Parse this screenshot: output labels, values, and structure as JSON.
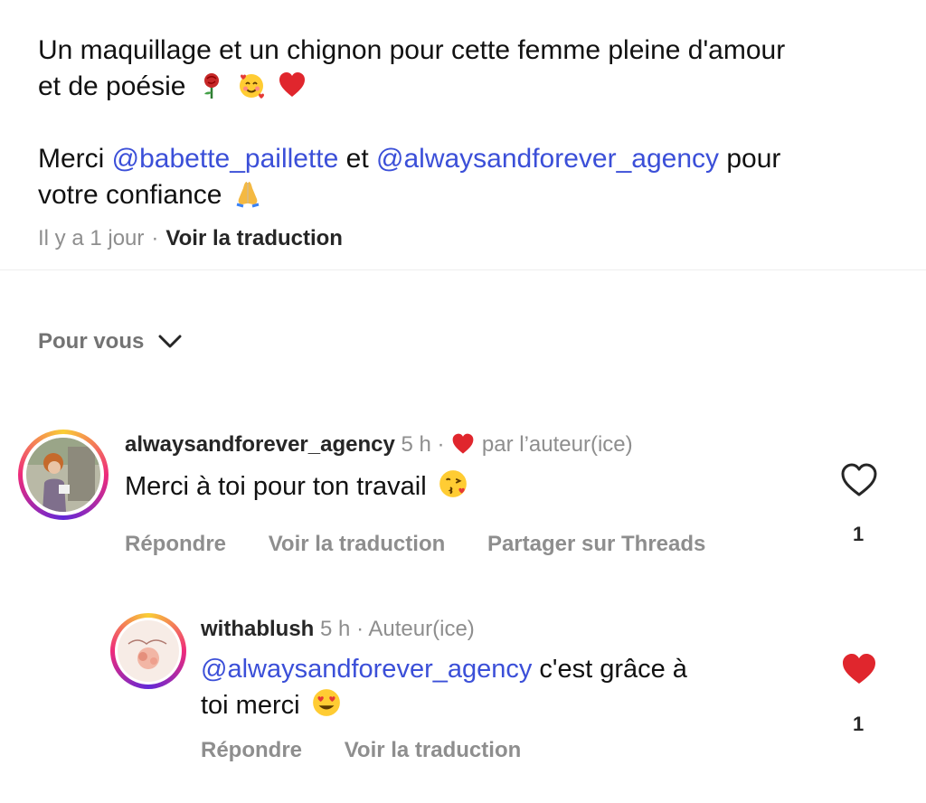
{
  "post": {
    "caption_line1": "Un maquillage et un chignon pour cette femme pleine d'amour",
    "caption_line2": "et de poésie",
    "caption_line3_prefix": "Merci ",
    "mention1": "@babette_paillette",
    "caption_line3_mid": " et ",
    "mention2": "@alwaysandforever_agency",
    "caption_line3_suffix": " pour",
    "caption_line4": "votre confiance",
    "time": "Il y a 1 jour",
    "separator": "·",
    "translate": "Voir la traduction"
  },
  "sort": {
    "label": "Pour vous"
  },
  "comments": [
    {
      "username": "alwaysandforever_agency",
      "time": "5 h",
      "separator": "·",
      "liked_by": "par l’auteur(ice)",
      "text": "Merci à toi pour ton travail",
      "actions": [
        "Répondre",
        "Voir la traduction",
        "Partager sur Threads"
      ],
      "like_count": "1",
      "liked": false
    },
    {
      "username": "withablush",
      "time": "5 h",
      "separator": "·",
      "role": "Auteur(ice)",
      "mention": "@alwaysandforever_agency",
      "text_rest": " c'est grâce à",
      "text_line2": "toi merci",
      "actions": [
        "Répondre",
        "Voir la traduction"
      ],
      "like_count": "1",
      "liked": true
    }
  ],
  "colors": {
    "mention": "#3b4fd8",
    "like_red": "#e0262d",
    "muted": "#8e8e8e"
  },
  "icons": {
    "rose": "rose-icon",
    "smiling_hearts": "smiling-face-with-hearts-icon",
    "red_heart": "red-heart-icon",
    "praying_hands": "folded-hands-icon",
    "kiss": "face-blowing-kiss-icon",
    "heart_eyes": "heart-eyes-icon",
    "like_outline": "heart-outline-icon",
    "like_filled": "heart-filled-icon",
    "chevron": "chevron-down-icon"
  }
}
